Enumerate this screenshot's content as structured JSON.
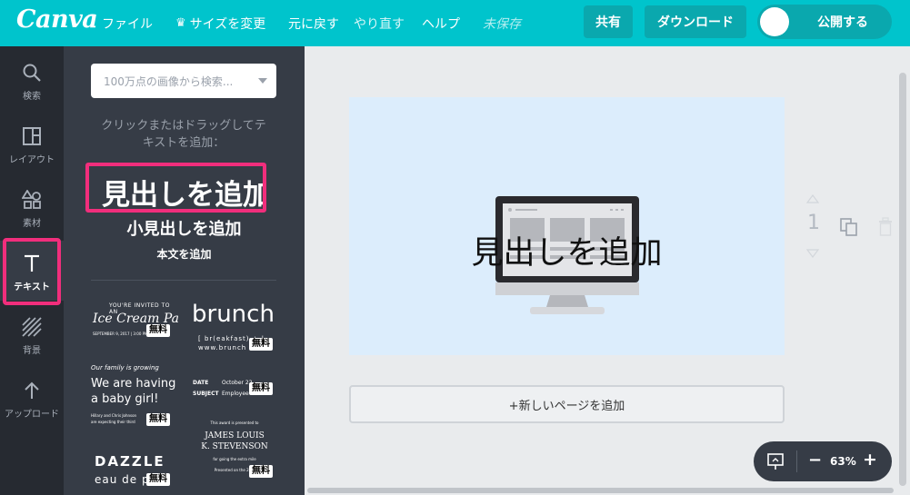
{
  "topbar": {
    "logo": "Canva",
    "menu_file": "ファイル",
    "menu_resize": "サイズを変更",
    "menu_undo": "元に戻す",
    "menu_redo": "やり直す",
    "menu_help": "ヘルプ",
    "status_unsaved": "未保存",
    "share_label": "共有",
    "download_label": "ダウンロード",
    "publish_label": "公開する",
    "brand_color": "#00c4cc",
    "accent_color": "#f12e7c"
  },
  "rail": {
    "items": [
      {
        "label": "検索",
        "icon": "search-icon"
      },
      {
        "label": "レイアウト",
        "icon": "layout-icon"
      },
      {
        "label": "素材",
        "icon": "elements-icon"
      },
      {
        "label": "テキスト",
        "icon": "text-icon"
      },
      {
        "label": "背景",
        "icon": "background-icon"
      },
      {
        "label": "アップロード",
        "icon": "upload-icon"
      }
    ],
    "active": "テキスト"
  },
  "panel": {
    "search_placeholder": "100万点の画像から検索...",
    "hint_line1": "クリックまたはドラッグしてテ",
    "hint_line2": "キストを追加：",
    "heading_label": "見出しを追加",
    "subheading_label": "小見出しを追加",
    "body_label": "本文を追加",
    "free_badge": "無料",
    "templates": {
      "t1_top": "YOU'RE INVITED TO AN",
      "t1_title": "Ice Cream Party",
      "t1_small": "SEPTEMBER 9, 2017 | 3:00 PM",
      "t2_title": "brunch",
      "t2_line1": "[ br(eakfast) + l",
      "t2_line2": "www.brunch",
      "t3_top": "Our family is growing",
      "t3_title1": "We are having",
      "t3_title2": "a baby girl!",
      "t3_small1": "Hillary and Chris Johnson",
      "t3_small2": "are expecting their third",
      "t4_date_label": "DATE",
      "t4_date_value": "October 22,",
      "t4_subject_label": "SUBJECT",
      "t4_subject_value": "Employee",
      "t5_title": "DAZZLE",
      "t5_sub": "eau de p",
      "t6_top": "This award is presented to",
      "t6_name1": "JAMES LOUIS",
      "t6_name2": "K. STEVENSON",
      "t6_small1": "for going the extra mile",
      "t6_small2": "Presented on the 28th"
    }
  },
  "canvas": {
    "page_heading": "見出しを追加",
    "page_number": "1",
    "add_page_label": "+新しいページを追加",
    "zoom": "63%"
  }
}
